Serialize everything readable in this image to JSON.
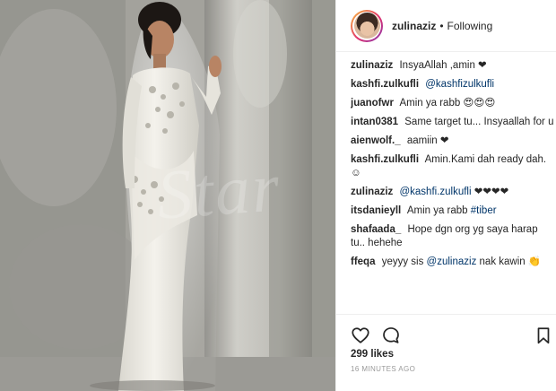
{
  "post": {
    "watermark": "Star",
    "author": "zulinaziz",
    "follow_status": "Following",
    "likes": "299 likes",
    "timestamp": "16 MINUTES AGO"
  },
  "comments": [
    {
      "user": "zulinaziz",
      "text": "InsyaAllah ,amin ❤"
    },
    {
      "user": "kashfi.zulkufli",
      "mention": "@kashfizulkufli"
    },
    {
      "user": "juanofwr",
      "text": "Amin ya rabb 😍😍😍"
    },
    {
      "user": "intan0381",
      "text": "Same target tu... Insyaallah for us 🙂"
    },
    {
      "user": "aienwolf._",
      "text": "aamiin ❤"
    },
    {
      "user": "kashfi.zulkufli",
      "text": "Amin.Kami dah ready dah. ☺"
    },
    {
      "user": "zulinaziz",
      "mention": "@kashfi.zulkufli",
      "text": "❤❤❤❤"
    },
    {
      "user": "itsdanieyll",
      "text": "Amin ya rabb",
      "tag": "#tiber"
    },
    {
      "user": "shafaada_",
      "text": "Hope dgn org yg saya harap tu.. hehehe"
    },
    {
      "user": "ffeqa",
      "text": "yeyyy sis",
      "mention": "@zulinaziz",
      "text2": "nak kawin 👏👏👏"
    }
  ],
  "icons": {
    "like": "heart-icon",
    "comment": "comment-icon",
    "save": "bookmark-icon"
  },
  "colors": {
    "link": "#003569",
    "muted": "#999999",
    "divider": "#efefef"
  }
}
